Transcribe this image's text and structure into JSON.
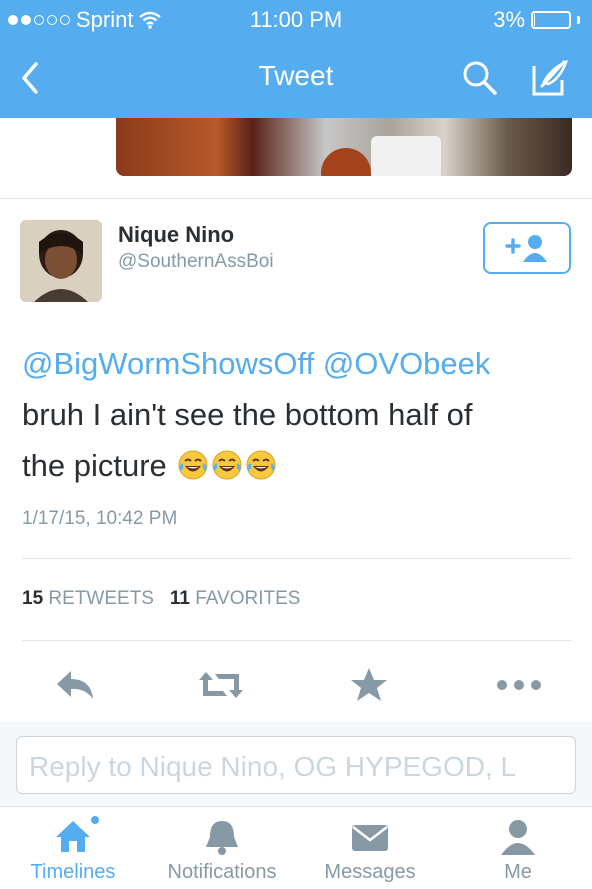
{
  "status_bar": {
    "carrier": "Sprint",
    "signal_dots_filled": 2,
    "signal_dots_total": 5,
    "time": "11:00 PM",
    "battery_percent": "3%",
    "battery_level": 0.03
  },
  "nav": {
    "back_icon": "chevron-left-icon",
    "title": "Tweet",
    "search_icon": "search-icon",
    "compose_icon": "compose-icon",
    "bar_color": "#55acee"
  },
  "tweet": {
    "author_name": "Nique Nino",
    "author_handle": "@SouthernAssBoi",
    "mention_1": "@BigWormShowsOff",
    "mention_2": "@OVObeek",
    "text_line_2": "bruh I ain't see the bottom half of",
    "text_line_3": "the picture",
    "emoji_count": 3,
    "emoji_name": "face-with-tears-of-joy",
    "timestamp": "1/17/15, 10:42 PM",
    "retweets_count": "15",
    "retweets_label": "RETWEETS",
    "favorites_count": "11",
    "favorites_label": "FAVORITES"
  },
  "actions": {
    "reply_icon": "reply-icon",
    "retweet_icon": "retweet-icon",
    "favorite_icon": "star-icon",
    "more_icon": "more-icon"
  },
  "reply": {
    "placeholder": "Reply to Nique Nino, OG HYPEGOD, L"
  },
  "tabs": [
    {
      "label": "Timelines",
      "icon": "home-icon",
      "active": true
    },
    {
      "label": "Notifications",
      "icon": "bell-icon",
      "active": false
    },
    {
      "label": "Messages",
      "icon": "envelope-icon",
      "active": false
    },
    {
      "label": "Me",
      "icon": "person-icon",
      "active": false
    }
  ],
  "colors": {
    "accent": "#55acee",
    "text": "#292f33",
    "muted": "#8899a6"
  }
}
